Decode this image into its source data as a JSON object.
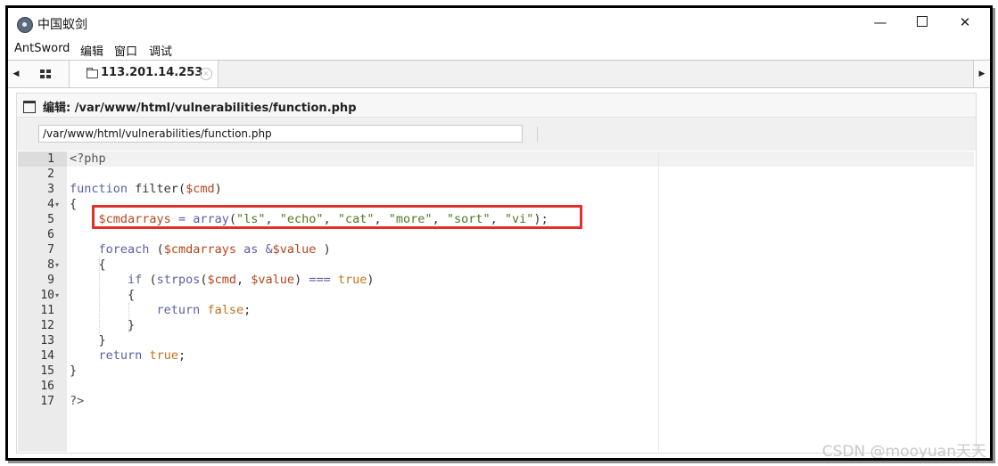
{
  "window": {
    "title": "中国蚁剑",
    "controls": {
      "minimize": "—",
      "maximize": "",
      "close": "✕"
    }
  },
  "menu": [
    "AntSword",
    "编辑",
    "窗口",
    "调试"
  ],
  "tabs": {
    "session_label": "113.201.14.253",
    "close_glyph": "×",
    "left_arrow": "◀",
    "right_arrow": "▶"
  },
  "editor_panel": {
    "title": "编辑: /var/www/html/vulnerabilities/function.php",
    "path_value": "/var/www/html/vulnerabilities/function.php"
  },
  "code": {
    "line_numbers": [
      "1",
      "2",
      "3",
      "4",
      "5",
      "6",
      "7",
      "8",
      "9",
      "10",
      "11",
      "12",
      "13",
      "14",
      "15",
      "16",
      "17"
    ],
    "fold_markers": {
      "4": "▾",
      "8": "▾",
      "10": "▾"
    },
    "lines": [
      "<?php",
      "",
      "function filter($cmd)",
      "{",
      "    $cmdarrays = array(\"ls\", \"echo\", \"cat\", \"more\", \"sort\", \"vi\");",
      "",
      "    foreach ($cmdarrays as &$value )",
      "    {",
      "        if (strpos($cmd, $value) === true)",
      "        {",
      "            return false;",
      "        }",
      "    }",
      "    return true;",
      "}",
      "",
      "?>"
    ],
    "highlighted_line": 5
  },
  "watermark": "CSDN @mooyuan天天",
  "colors": {
    "highlight_border": "#e0302a",
    "keyword": "#5b5ea6",
    "variable": "#b5451b",
    "string": "#4d7a1f",
    "constant": "#c0741b"
  },
  "icons": {
    "app": "antsword-logo-icon",
    "home_tab": "grid-icon",
    "session_tab": "folder-icon",
    "panel": "window-icon"
  }
}
